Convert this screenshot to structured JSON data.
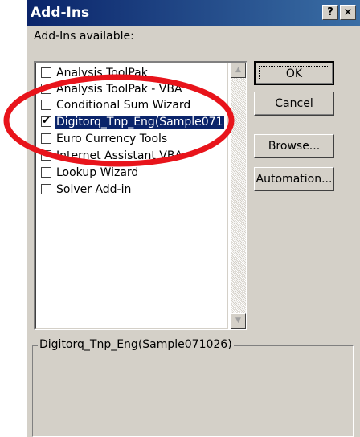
{
  "window": {
    "title": "Add-Ins",
    "help_glyph": "?",
    "close_glyph": "×"
  },
  "addins": {
    "available_label": "Add-Ins available:",
    "items": [
      {
        "label": "Analysis ToolPak",
        "checked": false,
        "selected": false
      },
      {
        "label": "Analysis ToolPak - VBA",
        "checked": false,
        "selected": false
      },
      {
        "label": "Conditional Sum Wizard",
        "checked": false,
        "selected": false
      },
      {
        "label": "Digitorq_Tnp_Eng(Sample071",
        "checked": true,
        "selected": true
      },
      {
        "label": "Euro Currency Tools",
        "checked": false,
        "selected": false
      },
      {
        "label": "Internet Assistant VBA",
        "checked": false,
        "selected": false
      },
      {
        "label": "Lookup Wizard",
        "checked": false,
        "selected": false
      },
      {
        "label": "Solver Add-in",
        "checked": false,
        "selected": false
      }
    ]
  },
  "buttons": {
    "ok": "OK",
    "cancel": "Cancel",
    "browse": "Browse...",
    "automation": "Automation..."
  },
  "description": {
    "title": "Digitorq_Tnp_Eng(Sample071026)",
    "text": ""
  },
  "annotation": {
    "color": "#e8141b"
  }
}
